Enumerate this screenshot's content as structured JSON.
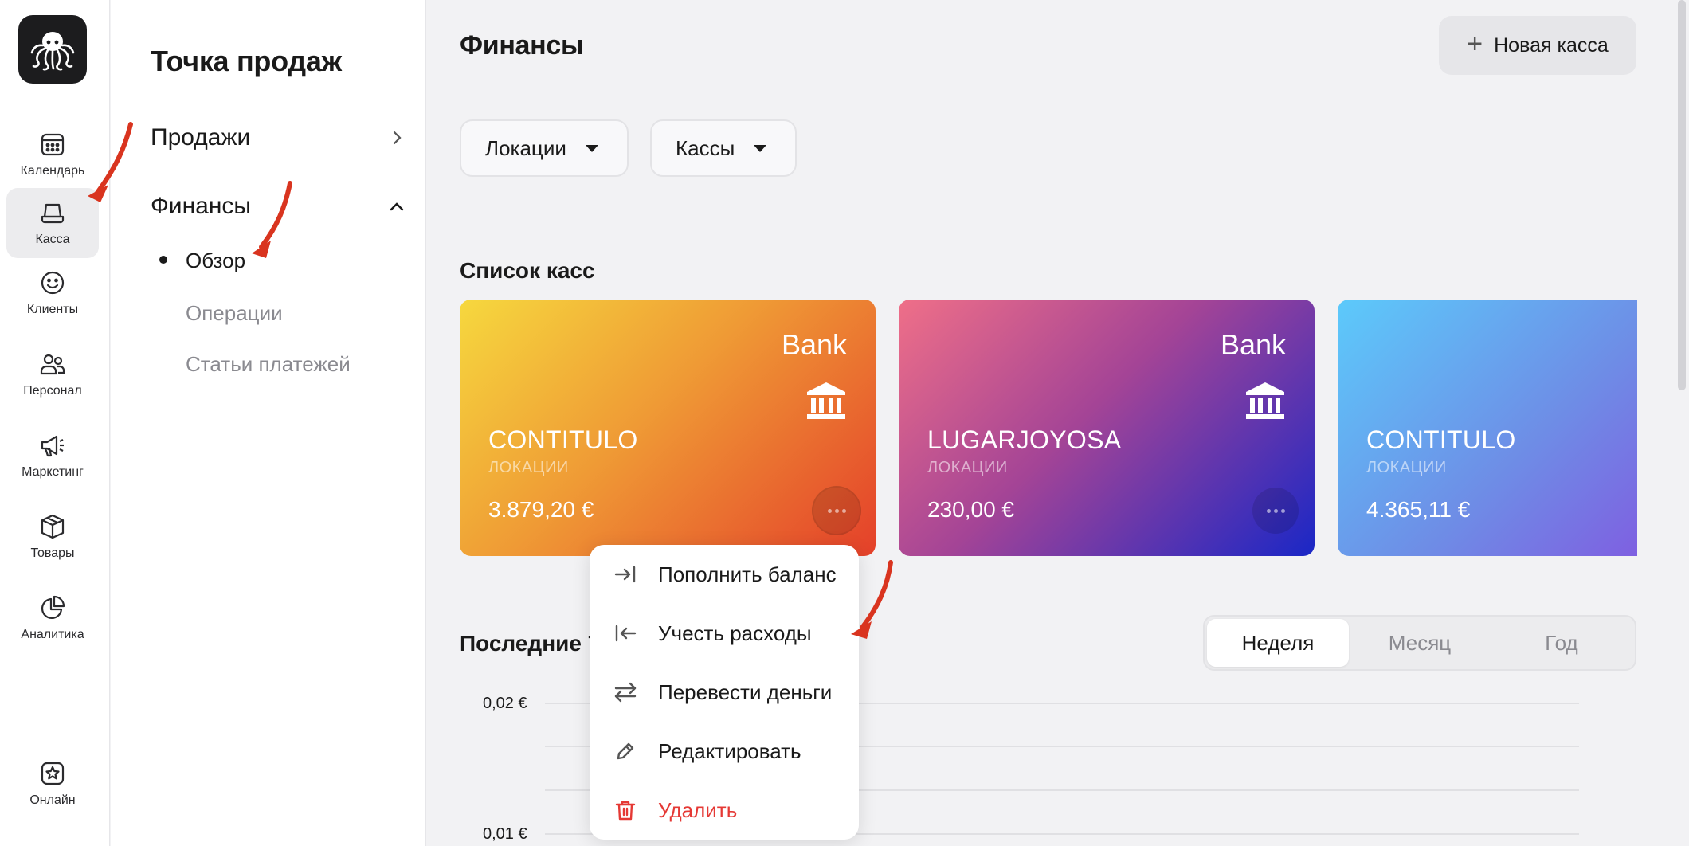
{
  "rail": {
    "items": [
      {
        "label": "Календарь",
        "icon": "calendar-icon"
      },
      {
        "label": "Касса",
        "icon": "cash-register-icon"
      },
      {
        "label": "Клиенты",
        "icon": "smile-icon"
      },
      {
        "label": "Персонал",
        "icon": "users-icon"
      },
      {
        "label": "Маркетинг",
        "icon": "megaphone-icon"
      },
      {
        "label": "Товары",
        "icon": "box-icon"
      },
      {
        "label": "Аналитика",
        "icon": "pie-chart-icon"
      },
      {
        "label": "Онлайн",
        "icon": "star-badge-icon"
      }
    ],
    "active": "Касса"
  },
  "sidebar": {
    "title": "Точка продаж",
    "groups": [
      {
        "label": "Продажи",
        "expanded": false
      },
      {
        "label": "Финансы",
        "expanded": true
      }
    ],
    "sub_items": [
      "Обзор",
      "Операции",
      "Статьи платежей"
    ],
    "active_sub": "Обзор"
  },
  "main": {
    "title": "Финансы",
    "new_button": "Новая касса",
    "filters": [
      "Локации",
      "Кассы"
    ],
    "list_title": "Список касс",
    "cards": [
      {
        "type": "Bank",
        "name": "CONTITULO",
        "location": "ЛОКАЦИИ",
        "amount": "3.879,20 €",
        "gradient": [
          "#f6d83e",
          "#e84f2a"
        ]
      },
      {
        "type": "Bank",
        "name": "LUGARJOYOSA",
        "location": "ЛОКАЦИИ",
        "amount": "230,00 €",
        "gradient": [
          "#ee6f8a",
          "#1c2bc4"
        ]
      },
      {
        "type": "",
        "name": "CONTITULO",
        "location": "ЛОКАЦИИ",
        "amount": "4.365,11 €",
        "gradient": [
          "#5ac8fa",
          "#8a4be0"
        ]
      }
    ],
    "recent_title": "Последние 7",
    "periods": [
      "Неделя",
      "Месяц",
      "Год"
    ],
    "active_period": "Неделя",
    "y_ticks": [
      "0,02 €",
      "0,01 €"
    ]
  },
  "context_menu": {
    "items": [
      {
        "label": "Пополнить баланс",
        "icon": "arrow-into-bar-icon"
      },
      {
        "label": "Учесть расходы",
        "icon": "arrow-out-bar-icon"
      },
      {
        "label": "Перевести деньги",
        "icon": "transfer-icon"
      },
      {
        "label": "Редактировать",
        "icon": "pencil-icon"
      },
      {
        "label": "Удалить",
        "icon": "trash-icon",
        "danger": true
      }
    ]
  },
  "colors": {
    "accent_red": "#e53935",
    "annotation_arrow": "#d9341f"
  }
}
